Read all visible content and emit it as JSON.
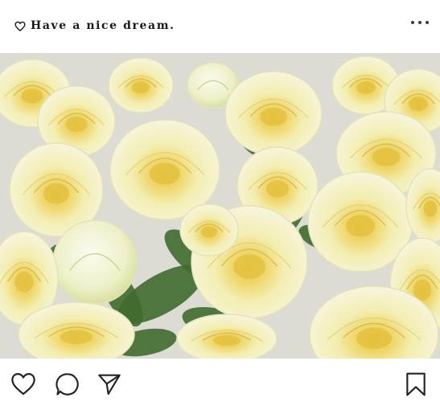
{
  "post": {
    "caption": "Have a nice dream.",
    "caption_icon": "heart-outline-icon",
    "menu_icon": "more-horizontal-icon"
  },
  "image": {
    "subject": "yellow spray roses bouquet",
    "colors": {
      "petal_light": "#f6f3cf",
      "petal_mid": "#efeaa9",
      "petal_center": "#e9d35a",
      "leaf": "#3f6a2e",
      "background": "#e2e2dc"
    }
  },
  "actions": {
    "like_icon": "heart-outline-icon",
    "comment_icon": "comment-bubble-icon",
    "share_icon": "paper-plane-icon",
    "save_icon": "bookmark-icon"
  }
}
